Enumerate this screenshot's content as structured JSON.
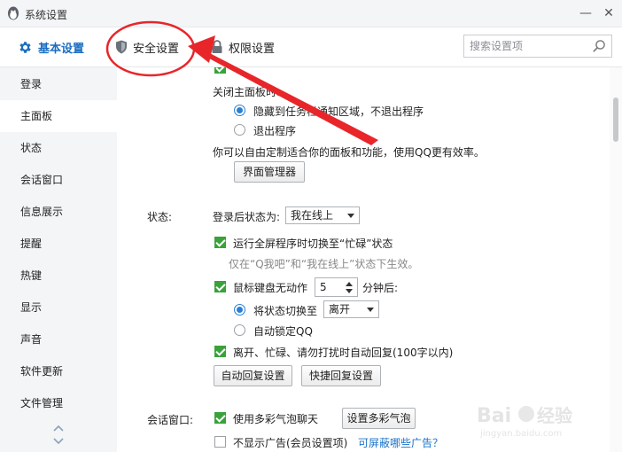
{
  "window": {
    "title": "系统设置"
  },
  "tabs": {
    "basic": "基本设置",
    "security": "安全设置",
    "permission": "权限设置"
  },
  "search": {
    "placeholder": "搜索设置项"
  },
  "sidebar": {
    "items": [
      {
        "label": "登录"
      },
      {
        "label": "主面板",
        "active": true
      },
      {
        "label": "状态"
      },
      {
        "label": "会话窗口"
      },
      {
        "label": "信息展示"
      },
      {
        "label": "提醒"
      },
      {
        "label": "热键"
      },
      {
        "label": "显示"
      },
      {
        "label": "声音"
      },
      {
        "label": "软件更新"
      },
      {
        "label": "文件管理"
      }
    ]
  },
  "main_panel": {
    "close_label": "关闭主面板时:",
    "option_hide": "隐藏到任务栏通知区域，不退出程序",
    "option_exit": "退出程序",
    "customize_desc": "你可以自由定制适合你的面板和功能，使用QQ更有效率。",
    "interface_manager_button": "界面管理器"
  },
  "status_section": {
    "section_label": "状态:",
    "after_login_label": "登录后状态为:",
    "after_login_value": "我在线上",
    "fullscreen_busy": "运行全屏程序时切换至“忙碌”状态",
    "fullscreen_hint": "仅在“Q我吧”和“我在线上”状态下生效。",
    "idle_prefix": "鼠标键盘无动作",
    "idle_minutes": "5",
    "idle_suffix": "分钟后:",
    "switch_to_label": "将状态切换至",
    "switch_to_value": "离开",
    "auto_lock": "自动锁定QQ",
    "auto_reply": "离开、忙碌、请勿打扰时自动回复(100字以内)",
    "auto_reply_button": "自动回复设置",
    "quick_reply_button": "快捷回复设置"
  },
  "chat_section": {
    "section_label": "会话窗口:",
    "colorful_bubble": "使用多彩气泡聊天",
    "bubble_button": "设置多彩气泡",
    "no_ads": "不显示广告(会员设置项)",
    "ads_link": "可屏蔽哪些广告？"
  },
  "colors": {
    "accent": "#1b6ec2",
    "check": "#3aa23a",
    "annotation": "#e8262a"
  }
}
